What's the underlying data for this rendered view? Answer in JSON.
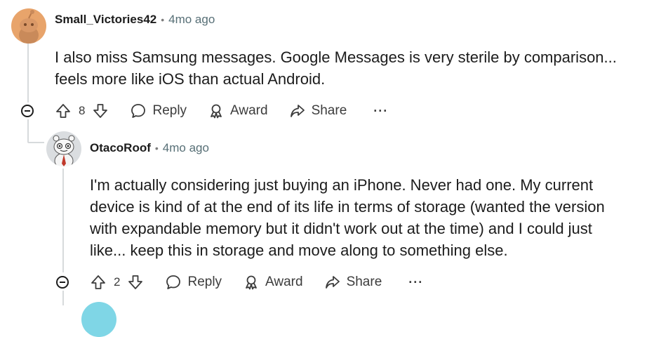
{
  "comments": [
    {
      "username": "Small_Victories42",
      "separator": "•",
      "time": "4mo ago",
      "lines": [
        "I also miss Samsung messages. Google Messages is very sterile by comparison...",
        "feels more like iOS than actual Android."
      ],
      "votes": "8",
      "reply_label": "Reply",
      "award_label": "Award",
      "share_label": "Share",
      "more_label": "···",
      "avatar_color": "#e8a46b"
    },
    {
      "username": "OtacoRoof",
      "separator": "•",
      "time": "4mo ago",
      "lines": [
        "I'm actually considering just buying an iPhone. Never had one. My current",
        "device is kind of at the end of its life in terms of storage (wanted the version",
        "with expandable memory but it didn't work out at the time) and I could just",
        "like... keep this in storage and move along to something else."
      ],
      "votes": "2",
      "reply_label": "Reply",
      "award_label": "Award",
      "share_label": "Share",
      "more_label": "···",
      "avatar_color": "#dadde0"
    }
  ]
}
